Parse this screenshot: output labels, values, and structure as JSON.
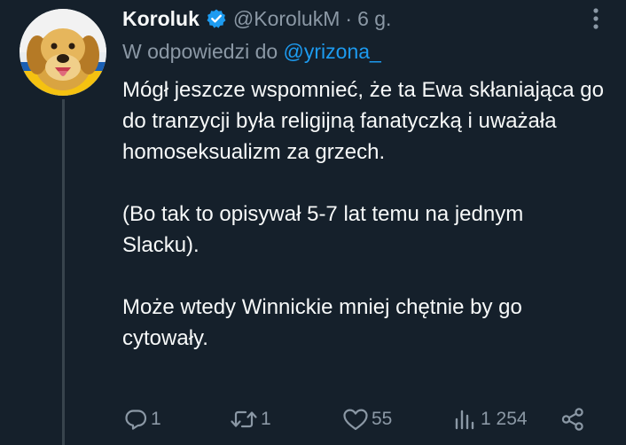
{
  "author": {
    "display_name": "Koroluk",
    "handle": "@KorolukM",
    "separator": "·",
    "time": "6 g."
  },
  "reply_to": {
    "prefix": "W odpowiedzi do",
    "mention": "@yrizona_"
  },
  "body": {
    "paragraph_1": "Mógł jeszcze wspomnieć, że ta Ewa skłaniająca go do tranzycji była religijną fanatyczką i uważała homoseksualizm za grzech.",
    "paragraph_2": "(Bo tak to opisywał 5-7 lat temu na jednym Slacku).",
    "paragraph_3": "Może wtedy Winnickie mniej chętnie by go cytowały."
  },
  "actions": {
    "replies": "1",
    "retweets": "1",
    "likes": "55",
    "views": "1 254"
  },
  "icons": {
    "verified": "verified-badge-icon",
    "more": "more-dots-icon",
    "reply": "reply-icon",
    "retweet": "retweet-icon",
    "like": "heart-icon",
    "views": "views-bar-chart-icon",
    "share": "share-icon"
  },
  "colors": {
    "background": "#15202b",
    "primary_text": "#f7f9f9",
    "secondary_text": "#8b98a5",
    "accent": "#1d9bf0",
    "thread_line": "#38444d"
  }
}
